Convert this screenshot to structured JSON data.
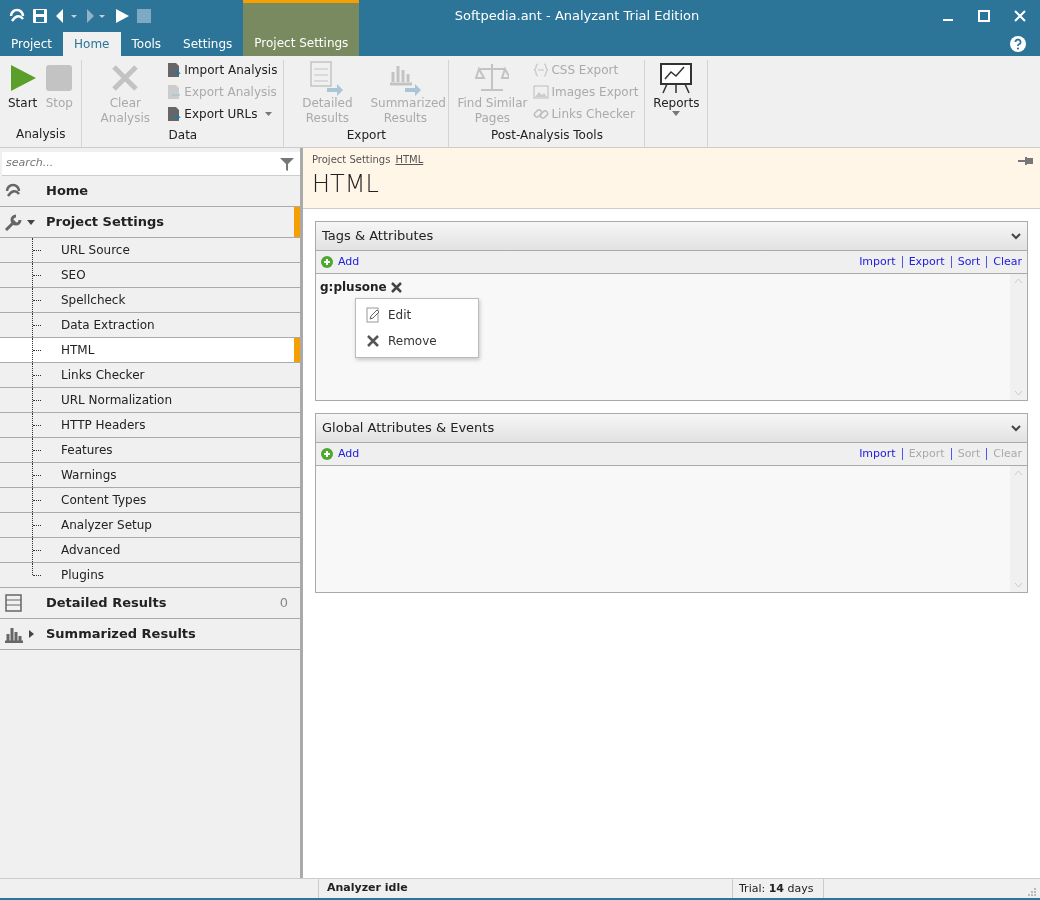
{
  "window": {
    "title": "Softpedia.ant - Analyzant Trial Edition"
  },
  "ribbon_tabs": [
    {
      "label": "Project",
      "selected": false,
      "contextual": false
    },
    {
      "label": "Home",
      "selected": true,
      "contextual": false
    },
    {
      "label": "Tools",
      "selected": false,
      "contextual": false
    },
    {
      "label": "Settings",
      "selected": false,
      "contextual": false
    },
    {
      "label": "Project Settings",
      "selected": false,
      "contextual": true
    }
  ],
  "ribbon_groups": [
    {
      "label": "Analysis",
      "items": [
        {
          "kind": "large",
          "label": "Start",
          "disabled": false
        },
        {
          "kind": "large",
          "label": "Stop",
          "disabled": true
        }
      ]
    },
    {
      "label": "Data",
      "items": [
        {
          "kind": "large",
          "label": "Clear Analysis",
          "disabled": true
        },
        {
          "kind": "small",
          "label": "Import Analysis",
          "disabled": false
        },
        {
          "kind": "small",
          "label": "Export Analysis",
          "disabled": true
        },
        {
          "kind": "small",
          "label": "Export URLs",
          "disabled": false,
          "dropdown": true
        }
      ]
    },
    {
      "label": "Export",
      "items": [
        {
          "kind": "large",
          "label": "Detailed Results",
          "disabled": true
        },
        {
          "kind": "large",
          "label": "Summarized Results",
          "disabled": true
        }
      ]
    },
    {
      "label": "Post-Analysis Tools",
      "items": [
        {
          "kind": "large",
          "label": "Find Similar Pages",
          "disabled": true
        },
        {
          "kind": "small",
          "label": "CSS Export",
          "disabled": true
        },
        {
          "kind": "small",
          "label": "Images Export",
          "disabled": true
        },
        {
          "kind": "small",
          "label": "Links Checker",
          "disabled": true
        }
      ]
    },
    {
      "items": [
        {
          "kind": "large",
          "label": "Reports",
          "disabled": false,
          "dropdown": true
        }
      ]
    }
  ],
  "sidebar": {
    "search": {
      "placeholder": "search..."
    },
    "items": [
      {
        "label": "Home",
        "active": false
      },
      {
        "label": "Project Settings",
        "active": true,
        "expanded": true,
        "children": [
          {
            "label": "URL Source",
            "selected": false
          },
          {
            "label": "SEO",
            "selected": false
          },
          {
            "label": "Spellcheck",
            "selected": false
          },
          {
            "label": "Data Extraction",
            "selected": false
          },
          {
            "label": "HTML",
            "selected": true
          },
          {
            "label": "Links Checker",
            "selected": false
          },
          {
            "label": "URL Normalization",
            "selected": false
          },
          {
            "label": "HTTP Headers",
            "selected": false
          },
          {
            "label": "Features",
            "selected": false
          },
          {
            "label": "Warnings",
            "selected": false
          },
          {
            "label": "Content Types",
            "selected": false
          },
          {
            "label": "Analyzer Setup",
            "selected": false
          },
          {
            "label": "Advanced",
            "selected": false
          },
          {
            "label": "Plugins",
            "selected": false
          }
        ]
      },
      {
        "label": "Detailed Results",
        "active": false,
        "count": "0"
      },
      {
        "label": "Summarized Results",
        "active": false,
        "expanded": false
      }
    ]
  },
  "breadcrumb": [
    {
      "label": "Project Settings",
      "link": false
    },
    {
      "label": "HTML",
      "link": true
    }
  ],
  "page_title": "HTML",
  "panels": [
    {
      "title": "Tags & Attributes",
      "add_label": "Add",
      "actions": [
        {
          "label": "Import",
          "disabled": false
        },
        {
          "label": "Export",
          "disabled": false
        },
        {
          "label": "Sort",
          "disabled": false
        },
        {
          "label": "Clear",
          "disabled": false
        }
      ],
      "items": [
        {
          "label": "g:plusone"
        }
      ]
    },
    {
      "title": "Global Attributes & Events",
      "add_label": "Add",
      "actions": [
        {
          "label": "Import",
          "disabled": false
        },
        {
          "label": "Export",
          "disabled": true
        },
        {
          "label": "Sort",
          "disabled": true
        },
        {
          "label": "Clear",
          "disabled": true
        }
      ]
    }
  ],
  "context_menu": {
    "items": [
      {
        "label": "Edit"
      },
      {
        "label": "Remove"
      }
    ]
  },
  "status_bar": {
    "status": "Analyzer idle",
    "trial": "Trial: **14** days"
  }
}
